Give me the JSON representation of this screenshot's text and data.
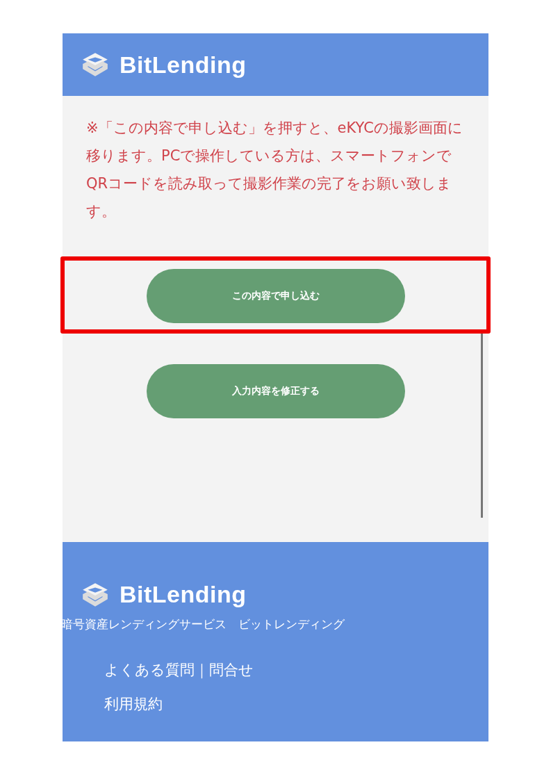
{
  "header": {
    "logo_text": "BitLending"
  },
  "notice": "※「この内容で申し込む」を押すと、eKYCの撮影画面に移ります。PCで操作している方は、スマートフォンでQRコードを読み取って撮影作業の完了をお願い致します。",
  "buttons": [
    {
      "label": "この内容で申し込む",
      "highlighted": true
    },
    {
      "label": "入力内容を修正する",
      "highlighted": false
    }
  ],
  "footer": {
    "logo_text": "BitLending",
    "tagline": "暗号資産レンディングサービス　ビットレンディング",
    "links": [
      "よくある質問｜問合せ",
      "利用規約"
    ]
  }
}
